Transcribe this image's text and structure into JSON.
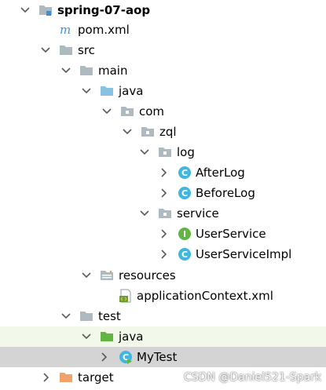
{
  "tree": {
    "project": "spring-07-aop",
    "pom": "pom.xml",
    "src": "src",
    "main": "main",
    "main_java": "java",
    "com": "com",
    "zql": "zql",
    "log": "log",
    "after_log": "AfterLog",
    "before_log": "BeforeLog",
    "service": "service",
    "user_service": "UserService",
    "user_service_impl": "UserServiceImpl",
    "resources": "resources",
    "app_context": "applicationContext.xml",
    "test": "test",
    "test_java": "java",
    "my_test": "MyTest",
    "target": "target"
  },
  "icon_letters": {
    "class": "C",
    "interface": "I"
  },
  "watermark": "CSDN @Daniel521-Spark",
  "colors": {
    "folder": "#aeb9c0",
    "source_folder": "#87c3e0",
    "test_folder": "#62b543",
    "target_folder": "#f2a268",
    "class_icon": "#40b6e0",
    "interface_icon": "#62b543",
    "arrow": "#5b5b5b",
    "selection": "#d4d4d4",
    "test_highlight": "#f2f8ea"
  }
}
